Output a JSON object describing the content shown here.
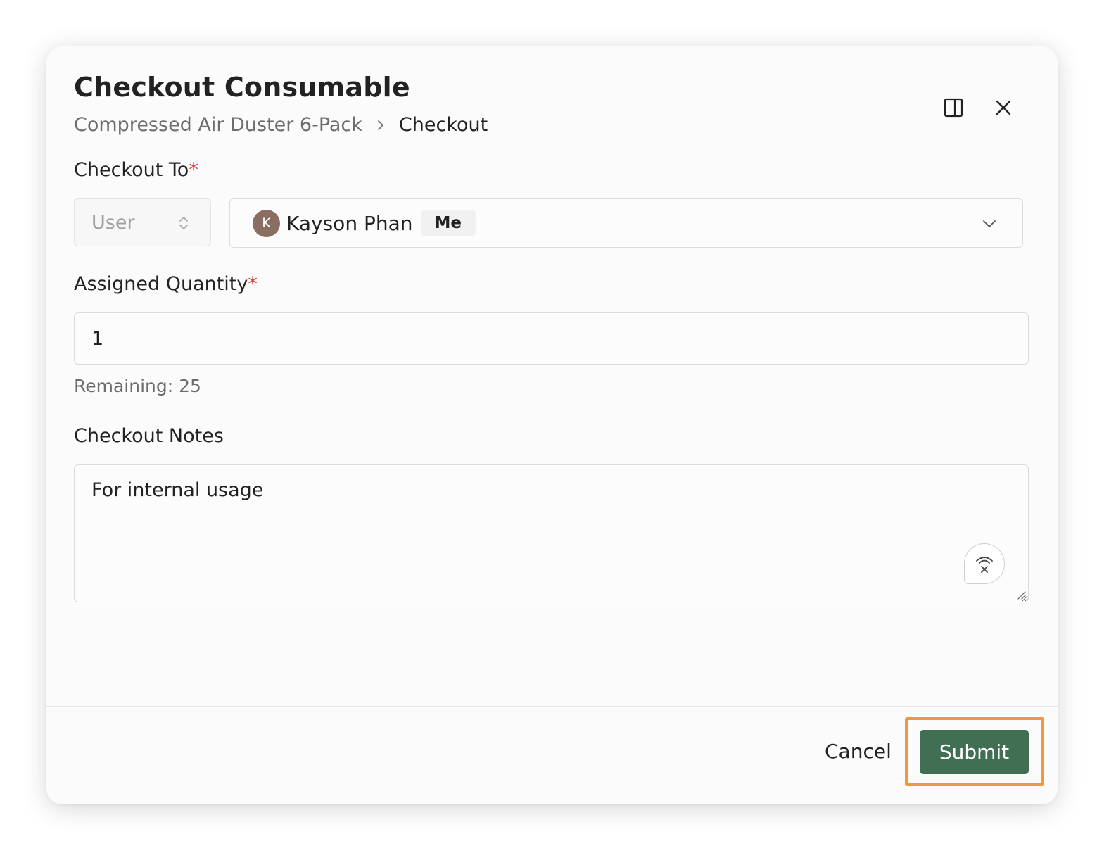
{
  "dialog": {
    "title": "Checkout Consumable",
    "breadcrumb": {
      "parent": "Compressed Air Duster 6-Pack",
      "current": "Checkout"
    },
    "header_icons": [
      "panel-toggle-icon",
      "close-icon"
    ]
  },
  "checkout_to": {
    "label": "Checkout To",
    "required_mark": "*",
    "type_select": {
      "value": "User",
      "icon": "updown-chevron-icon"
    },
    "user_select": {
      "avatar_initial": "K",
      "name": "Kayson Phan",
      "badge": "Me",
      "icon": "chevron-down-icon"
    }
  },
  "quantity": {
    "label": "Assigned Quantity",
    "required_mark": "*",
    "value": "1",
    "helper": "Remaining: 25"
  },
  "notes": {
    "label": "Checkout Notes",
    "value": "For internal usage",
    "dictation_icon": "dictation-icon"
  },
  "footer": {
    "cancel_label": "Cancel",
    "submit_label": "Submit"
  },
  "colors": {
    "primary": "#416f53",
    "required": "#e23c2c",
    "highlight": "#f0983a",
    "avatar": "#8a6e62"
  }
}
